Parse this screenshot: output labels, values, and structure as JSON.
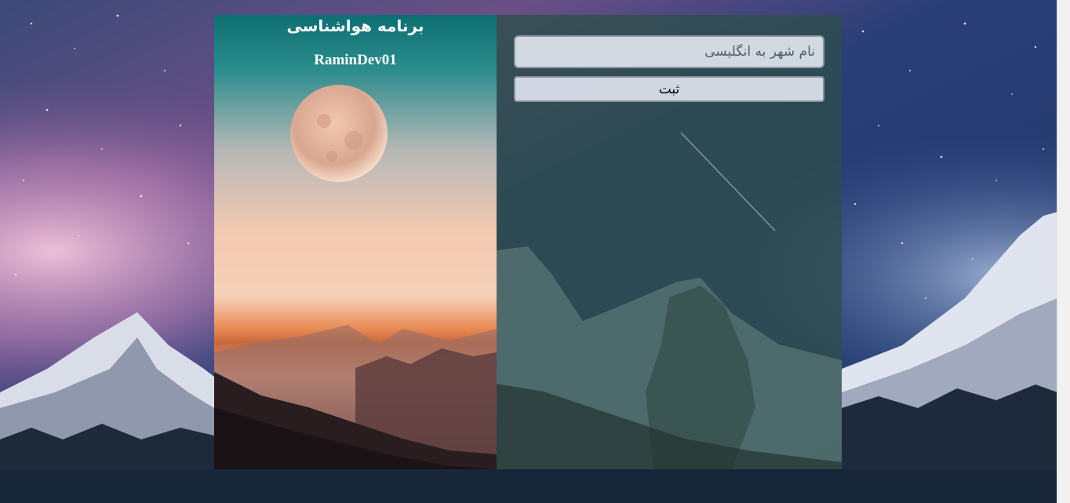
{
  "header": {
    "app_title": "برنامه هواشناسی",
    "author": "RaminDev01"
  },
  "form": {
    "city_input": {
      "placeholder": "نام شهر به انگلیسی",
      "value": ""
    },
    "submit_label": "ثبت"
  },
  "colors": {
    "right_panel_overlay": "#2e4e4a",
    "input_background": "#e8edf5",
    "button_background": "#dee3ee",
    "title_text": "#ffffff"
  }
}
